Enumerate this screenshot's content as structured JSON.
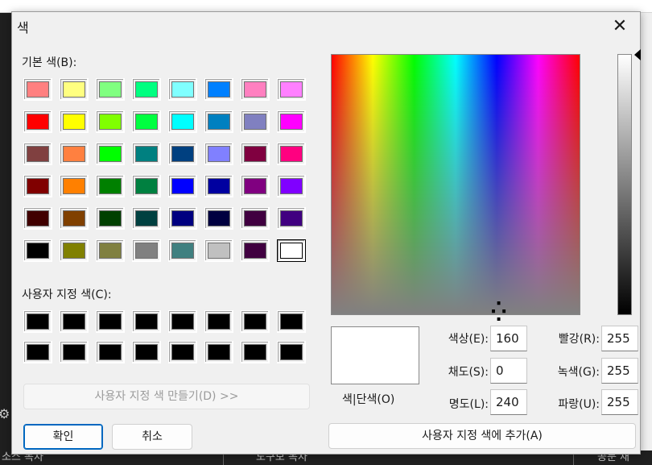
{
  "dialog": {
    "title": "색",
    "close_symbol": "✕",
    "basic_colors_label": "기본 색(B):",
    "custom_colors_label": "사용자 지정 색(C):",
    "define_custom_label": "사용자 지정 색 만들기(D) >>",
    "ok_label": "확인",
    "cancel_label": "취소",
    "add_custom_label": "사용자 지정 색에 추가(A)",
    "preview_label": "색|단색(O)"
  },
  "basic_colors": [
    "#ff8080",
    "#ffff80",
    "#80ff80",
    "#00ff80",
    "#80ffff",
    "#0080ff",
    "#ff80c0",
    "#ff80ff",
    "#ff0000",
    "#ffff00",
    "#80ff00",
    "#00ff40",
    "#00ffff",
    "#0080c0",
    "#8080c0",
    "#ff00ff",
    "#804040",
    "#ff8040",
    "#00ff00",
    "#008080",
    "#004080",
    "#8080ff",
    "#800040",
    "#ff0080",
    "#800000",
    "#ff8000",
    "#008000",
    "#008040",
    "#0000ff",
    "#0000a0",
    "#800080",
    "#8000ff",
    "#400000",
    "#804000",
    "#004000",
    "#004040",
    "#000080",
    "#000040",
    "#400040",
    "#400080",
    "#000000",
    "#808000",
    "#808040",
    "#808080",
    "#408080",
    "#c0c0c0",
    "#400040",
    "#ffffff"
  ],
  "selected_basic_index": 47,
  "custom_colors": [
    "#000000",
    "#000000",
    "#000000",
    "#000000",
    "#000000",
    "#000000",
    "#000000",
    "#000000",
    "#000000",
    "#000000",
    "#000000",
    "#000000",
    "#000000",
    "#000000",
    "#000000",
    "#000000"
  ],
  "fields": {
    "hue": {
      "label": "색상(E):",
      "value": "160"
    },
    "sat": {
      "label": "채도(S):",
      "value": "0"
    },
    "lum": {
      "label": "명도(L):",
      "value": "240"
    },
    "red": {
      "label": "빨강(R):",
      "value": "255"
    },
    "green": {
      "label": "녹색(G):",
      "value": "255"
    },
    "blue": {
      "label": "파랑(U):",
      "value": "255"
    }
  },
  "preview_color": "#ffffff",
  "crosshair_glyph": "⁛",
  "background": {
    "gear_icon": "⚙",
    "bottom_texts": [
      "소스 목차",
      "도구모 목차",
      "공문 재"
    ]
  }
}
